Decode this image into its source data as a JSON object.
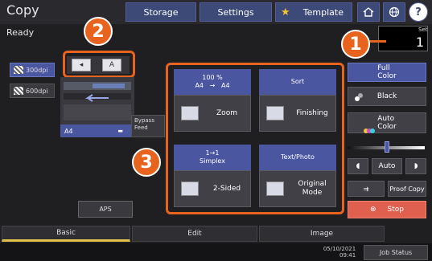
{
  "header": {
    "title": "Copy",
    "storage_label": "Storage",
    "settings_label": "Settings",
    "template_label": "Template",
    "home_icon": "home-icon",
    "globe_icon": "globe-icon",
    "help_label": "?"
  },
  "status": "Ready",
  "set": {
    "label": "Set",
    "value": "1"
  },
  "callouts": {
    "one": "1",
    "two": "2",
    "three": "3"
  },
  "left_panel": {
    "dpi_300": "300dpi",
    "dpi_600": "600dpi",
    "paper_size": "A4",
    "bypass_feed": "Bypass Feed",
    "aps_label": "APS"
  },
  "functions": {
    "zoom": {
      "head": "100 %\nA4   →   A4",
      "label": "Zoom"
    },
    "finishing": {
      "head": "Sort",
      "label": "Finishing"
    },
    "twosided": {
      "head": "1→1\nSimplex",
      "label": "2-Sided"
    },
    "original": {
      "head": "Text/Photo",
      "label": "Original\nMode"
    }
  },
  "right_panel": {
    "full_color": "Full\nColor",
    "black": "Black",
    "auto_color": "Auto\nColor",
    "auto": "Auto",
    "proof_copy": "Proof Copy",
    "stop": "Stop"
  },
  "tabs": {
    "basic": "Basic",
    "edit": "Edit",
    "image": "Image"
  },
  "footer": {
    "date": "05/10/2021",
    "time": "09:41",
    "job_status": "Job Status"
  },
  "colors": {
    "accent": "#4a56a0",
    "callout": "#e8641e",
    "stop": "#e06050",
    "active_tab": "#e0c24a"
  }
}
